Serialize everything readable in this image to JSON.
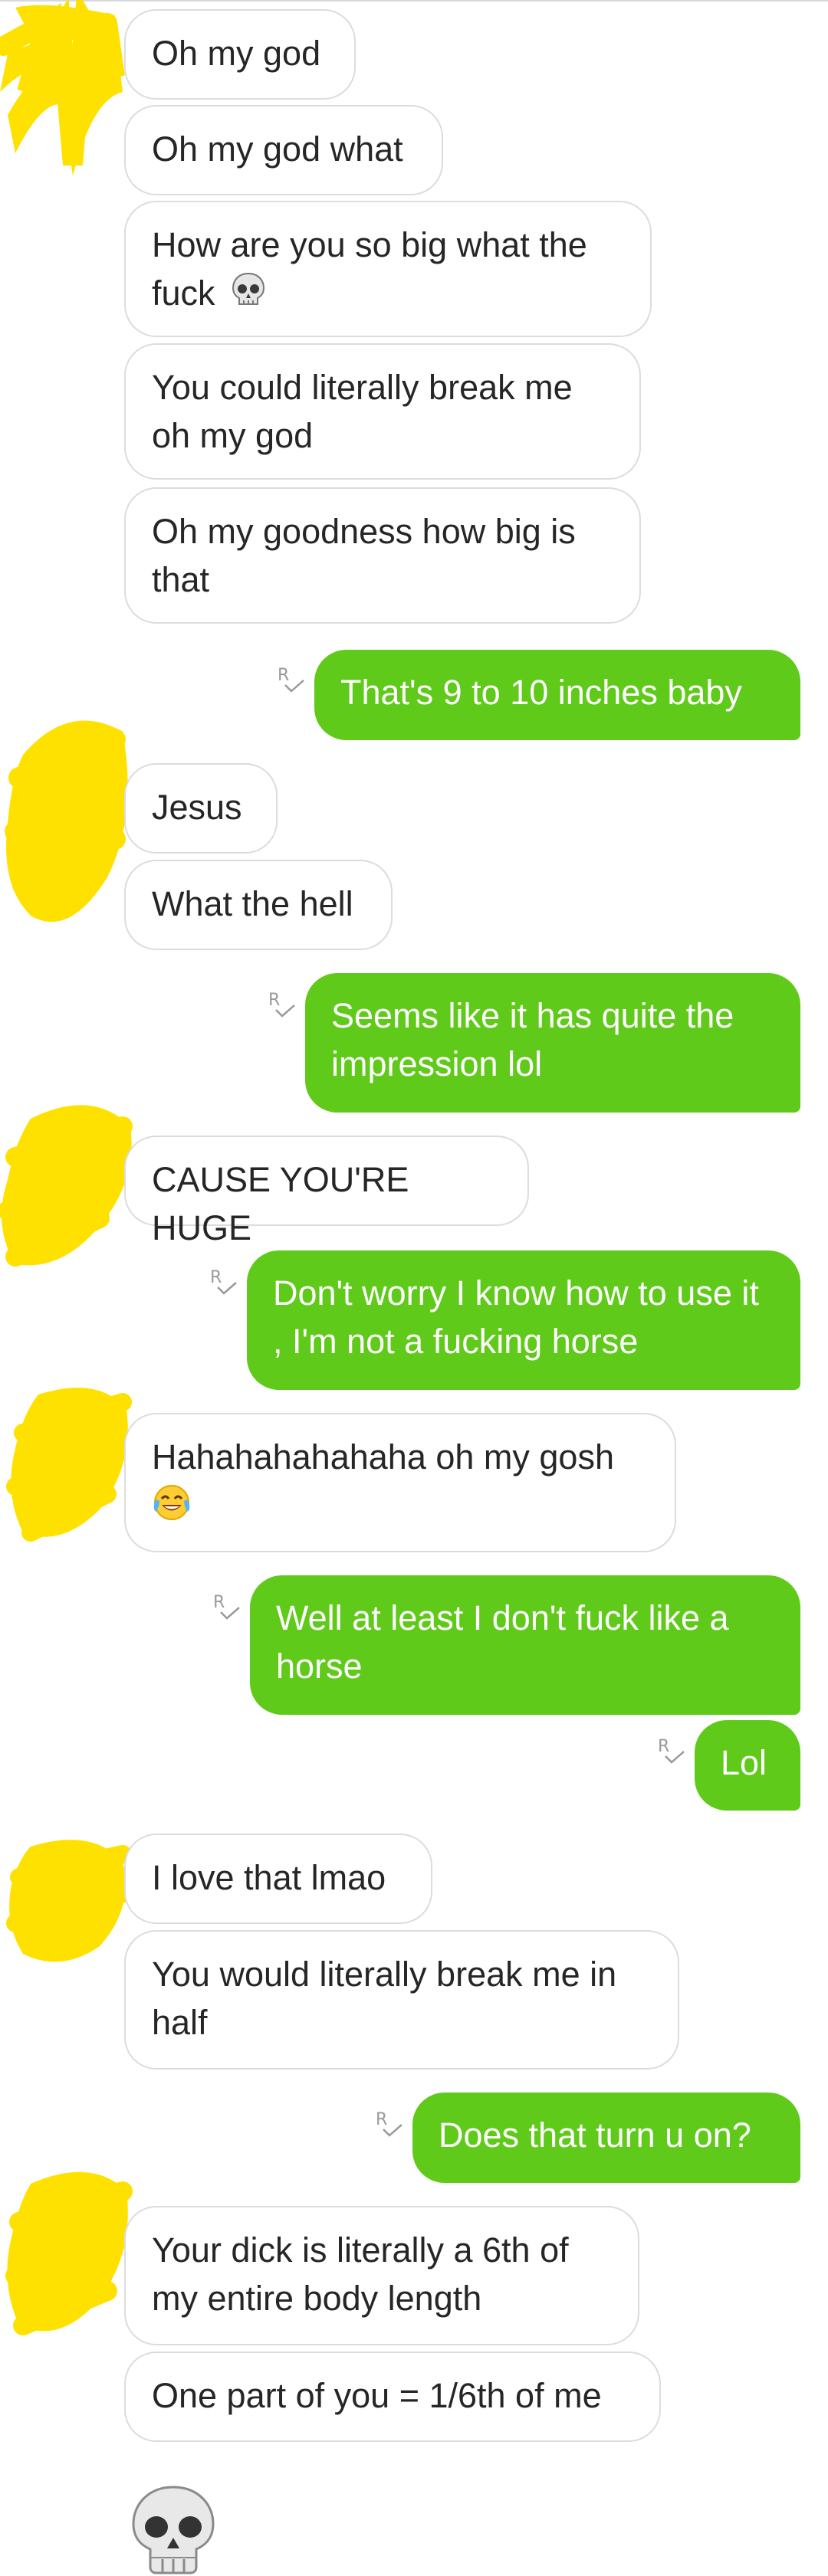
{
  "colors": {
    "outgoing_bubble": "#5fca19",
    "incoming_bubble": "#ffffff",
    "incoming_border": "#dcdcdc",
    "incoming_text": "#262626",
    "redaction_scribble": "#ffe100"
  },
  "read_receipt_letter": "R",
  "messages": [
    {
      "dir": "in",
      "text": "Oh my god"
    },
    {
      "dir": "in",
      "text": "Oh my god what"
    },
    {
      "dir": "in",
      "text": "How are you so big what the fuck",
      "emoji": "skull-emoji"
    },
    {
      "dir": "in",
      "text": "You could literally break me oh my god"
    },
    {
      "dir": "in",
      "text": "Oh my goodness how big is that"
    },
    {
      "dir": "out",
      "text": "That's 9 to 10 inches baby"
    },
    {
      "dir": "in",
      "text": "Jesus"
    },
    {
      "dir": "in",
      "text": "What the hell"
    },
    {
      "dir": "out",
      "text": "Seems like it has quite the impression lol"
    },
    {
      "dir": "in",
      "text": "CAUSE YOU'RE HUGE"
    },
    {
      "dir": "out",
      "text": "Don't worry I know how to use it , I'm not a fucking horse"
    },
    {
      "dir": "in",
      "text": "Hahahahahahaha oh my gosh",
      "emoji": "tears-of-joy-emoji"
    },
    {
      "dir": "out",
      "text": "Well at least I don't fuck like a horse"
    },
    {
      "dir": "out",
      "text": "Lol"
    },
    {
      "dir": "in",
      "text": "I love that lmao"
    },
    {
      "dir": "in",
      "text": "You would literally break me in half"
    },
    {
      "dir": "out",
      "text": "Does that turn u on?"
    },
    {
      "dir": "in",
      "text": "Your dick is literally a 6th of my entire body length"
    },
    {
      "dir": "in",
      "text": "One part of you = 1/6th of me"
    },
    {
      "dir": "in",
      "emoji_only": "skull-emoji"
    }
  ]
}
